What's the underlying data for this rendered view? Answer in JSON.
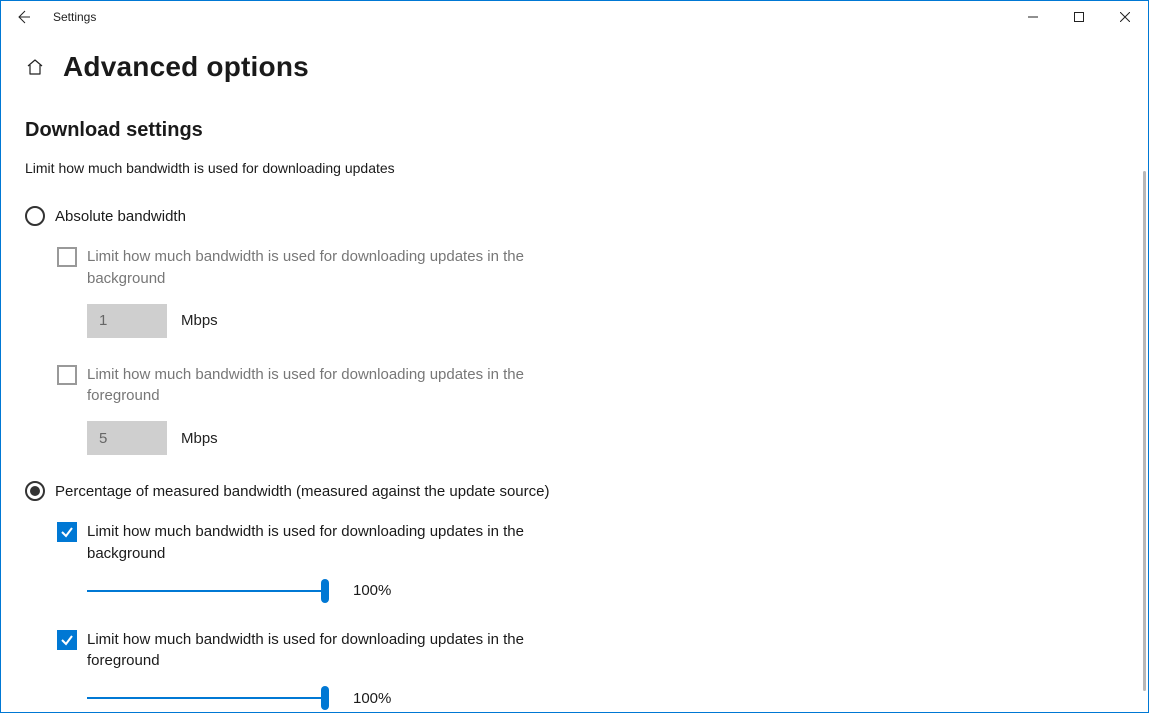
{
  "window": {
    "app_title": "Settings"
  },
  "page": {
    "title": "Advanced options",
    "section_heading": "Download settings",
    "section_desc": "Limit how much bandwidth is used for downloading updates"
  },
  "radios": {
    "absolute": {
      "label": "Absolute bandwidth",
      "selected": false
    },
    "percentage": {
      "label": "Percentage of measured bandwidth (measured against the update source)",
      "selected": true
    }
  },
  "absolute": {
    "background": {
      "label": "Limit how much bandwidth is used for downloading updates in the background",
      "checked": false,
      "value": "1",
      "unit": "Mbps"
    },
    "foreground": {
      "label": "Limit how much bandwidth is used for downloading updates in the foreground",
      "checked": false,
      "value": "5",
      "unit": "Mbps"
    }
  },
  "percentage": {
    "background": {
      "label": "Limit how much bandwidth is used for downloading updates in the background",
      "checked": true,
      "percent": 100,
      "percent_label": "100%"
    },
    "foreground": {
      "label": "Limit how much bandwidth is used for downloading updates in the foreground",
      "checked": true,
      "percent": 100,
      "percent_label": "100%"
    }
  }
}
